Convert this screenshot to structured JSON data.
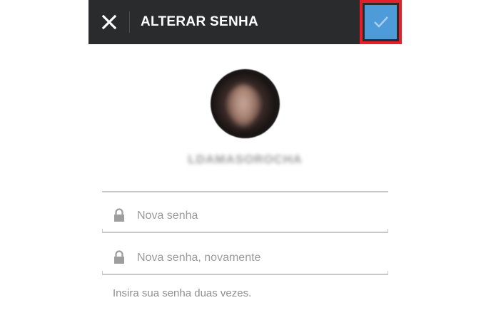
{
  "header": {
    "title": "ALTERAR SENHA",
    "close_icon": "close-icon",
    "confirm_icon": "checkmark-icon",
    "colors": {
      "bar": "#2a2b2d",
      "confirm": "#4d9bd8",
      "highlight": "#e3202b"
    }
  },
  "profile": {
    "username": "LDAMASOROCHA"
  },
  "form": {
    "new_password_placeholder": "Nova senha",
    "repeat_password_placeholder": "Nova senha, novamente",
    "hint": "Insira sua senha duas vezes.",
    "field_icon": "lock-icon"
  }
}
